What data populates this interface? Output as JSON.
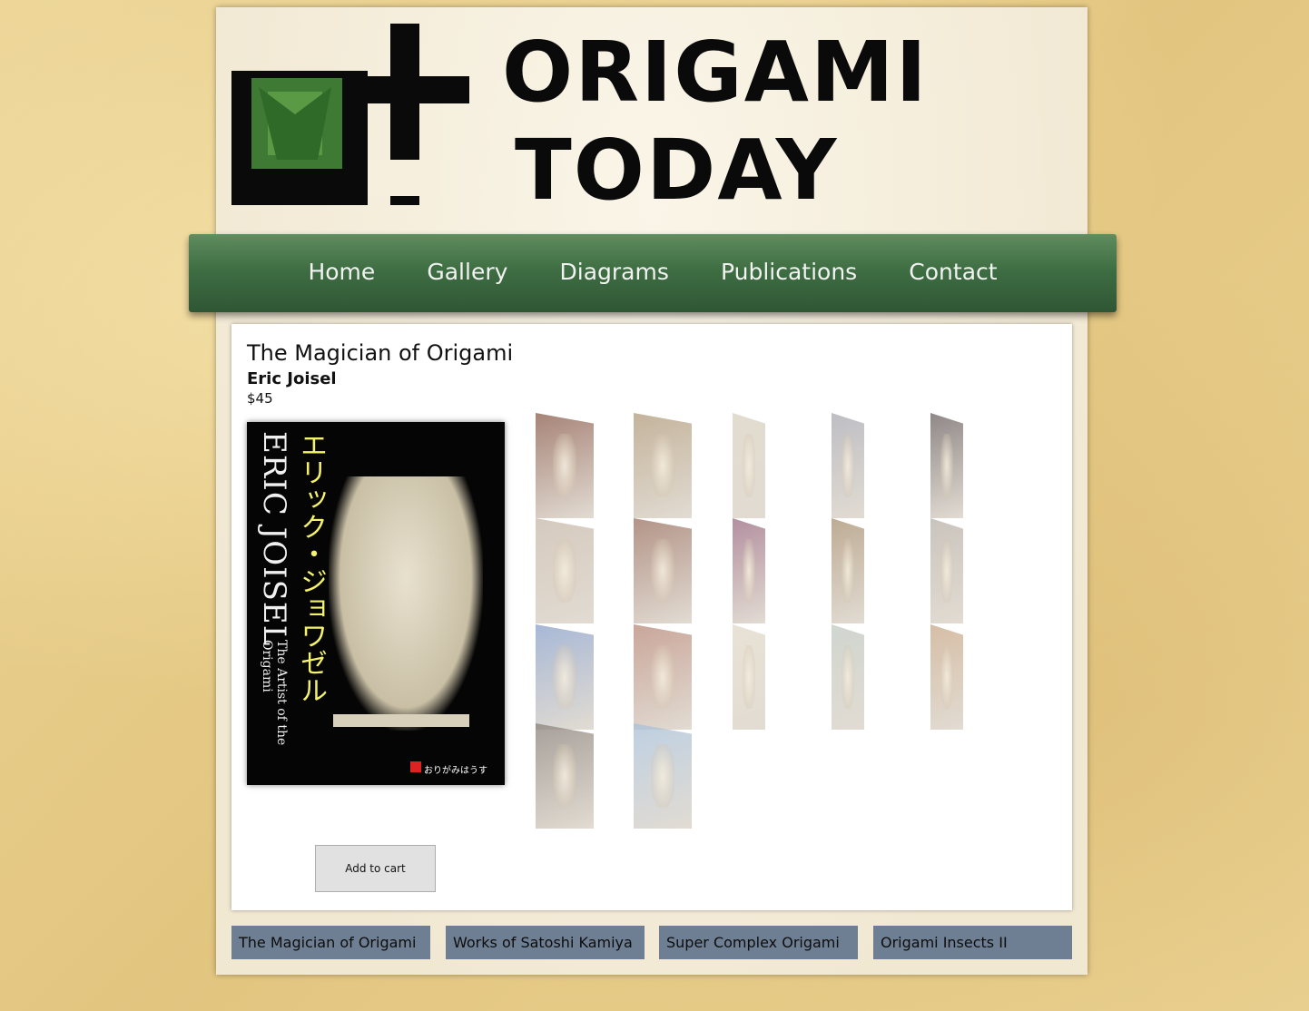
{
  "logo": {
    "line1": "ORIGAMI",
    "line2": "TODAY"
  },
  "nav": {
    "items": [
      "Home",
      "Gallery",
      "Diagrams",
      "Publications",
      "Contact"
    ]
  },
  "product": {
    "title": "The Magician of Origami",
    "author": "Eric Joisel",
    "price": "$45",
    "add_to_cart_label": "Add to cart",
    "cover": {
      "author_name": "ERIC JOISEL",
      "japanese_title": "エリック・ジョワゼル",
      "subtitle": "The Artist of the Origami",
      "publisher": "おりがみはうす"
    },
    "gallery_count": 17
  },
  "footer_tabs": [
    "The Magician of Origami",
    "Works of Satoshi Kamiya",
    "Super Complex Origami",
    "Origami Insects II"
  ],
  "colors": {
    "nav_green": "#3f6e43",
    "tab_bg": "#6e7f93",
    "page_bg": "#f6efde"
  }
}
